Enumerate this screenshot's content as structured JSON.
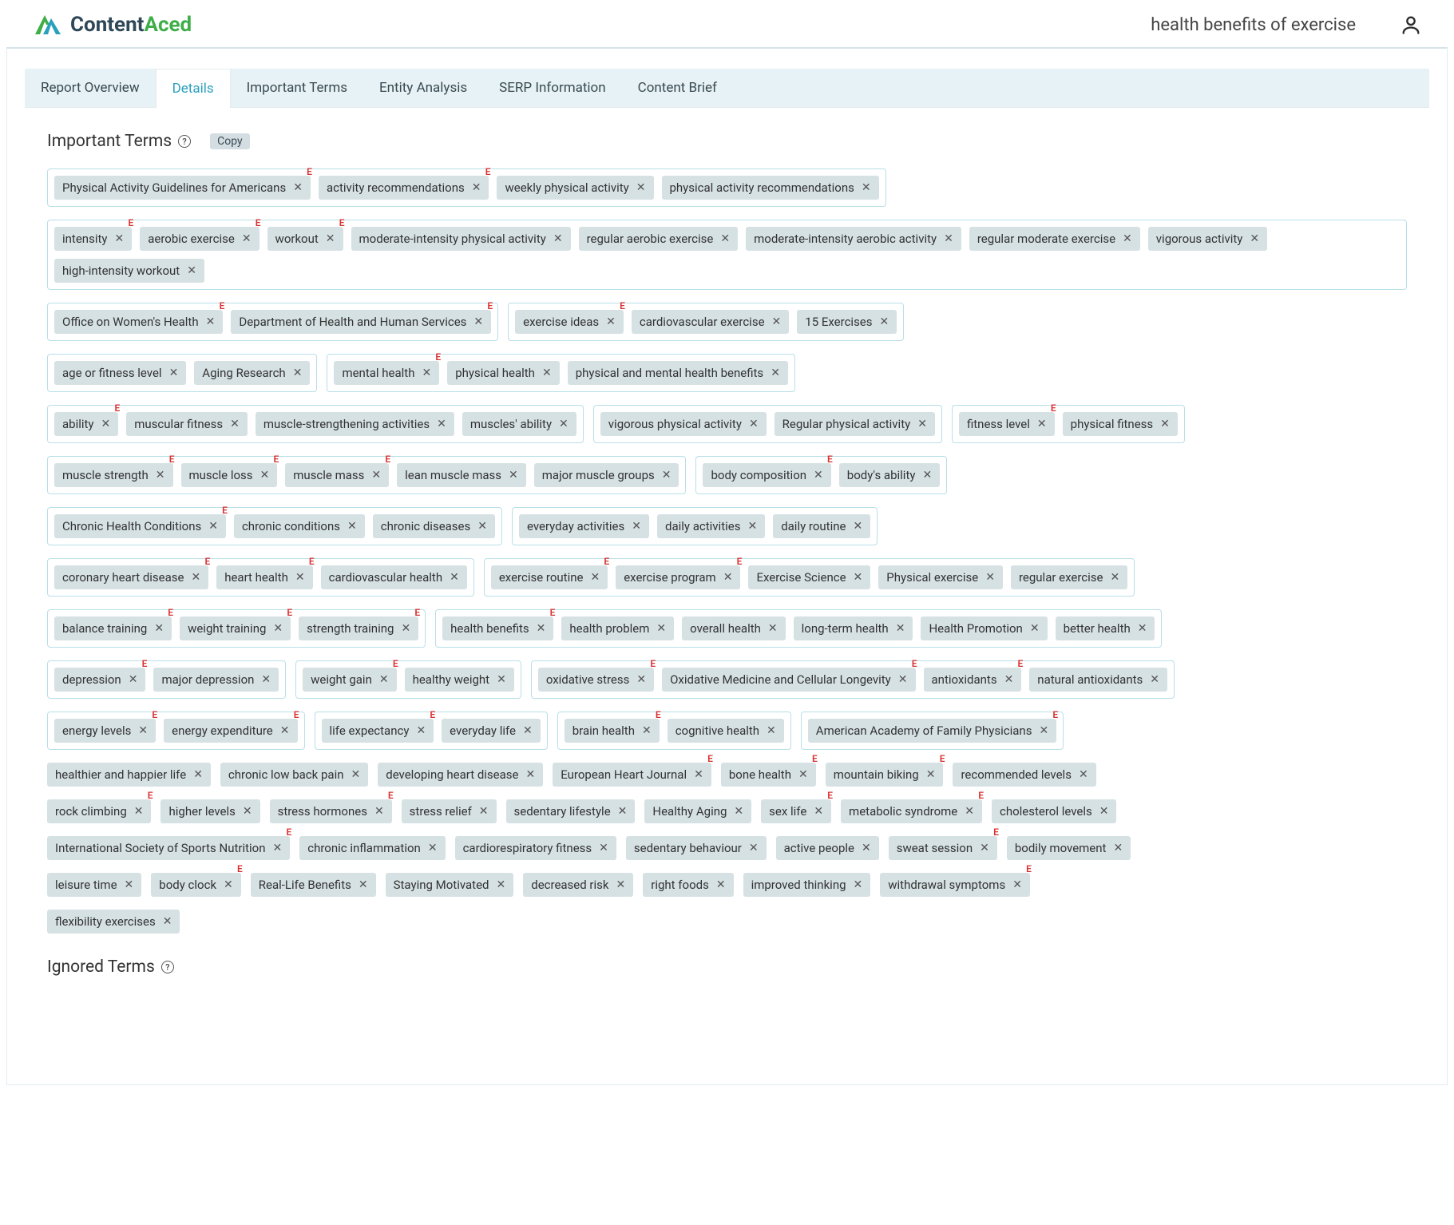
{
  "header": {
    "brand1": "Content",
    "brand2": "Aced",
    "title": "health benefits of exercise"
  },
  "tabs": [
    {
      "label": "Report Overview",
      "active": false
    },
    {
      "label": "Details",
      "active": true
    },
    {
      "label": "Important Terms",
      "active": false
    },
    {
      "label": "Entity Analysis",
      "active": false
    },
    {
      "label": "SERP Information",
      "active": false
    },
    {
      "label": "Content Brief",
      "active": false
    }
  ],
  "sections": {
    "important_title": "Important Terms",
    "copy_label": "Copy",
    "ignored_title": "Ignored Terms"
  },
  "rows": [
    [
      {
        "chips": [
          {
            "t": "Physical Activity Guidelines for Americans",
            "e": true
          },
          {
            "t": "activity recommendations",
            "e": true
          },
          {
            "t": "weekly physical activity"
          },
          {
            "t": "physical activity recommendations"
          }
        ]
      }
    ],
    [
      {
        "chips": [
          {
            "t": "intensity",
            "e": true
          },
          {
            "t": "aerobic exercise",
            "e": true
          },
          {
            "t": "workout",
            "e": true
          },
          {
            "t": "moderate-intensity physical activity"
          },
          {
            "t": "regular aerobic exercise"
          },
          {
            "t": "moderate-intensity aerobic activity"
          },
          {
            "t": "regular moderate exercise"
          },
          {
            "t": "vigorous activity"
          },
          {
            "t": "high-intensity workout"
          }
        ]
      }
    ],
    [
      {
        "chips": [
          {
            "t": "Office on Women's Health",
            "e": true
          },
          {
            "t": "Department of Health and Human Services",
            "e": true
          }
        ]
      },
      {
        "chips": [
          {
            "t": "exercise ideas",
            "e": true
          },
          {
            "t": "cardiovascular exercise"
          },
          {
            "t": "15 Exercises"
          }
        ]
      }
    ],
    [
      {
        "chips": [
          {
            "t": "age or fitness level"
          },
          {
            "t": "Aging Research"
          }
        ]
      },
      {
        "chips": [
          {
            "t": "mental health",
            "e": true
          },
          {
            "t": "physical health"
          },
          {
            "t": "physical and mental health benefits"
          }
        ]
      }
    ],
    [
      {
        "chips": [
          {
            "t": "ability",
            "e": true
          },
          {
            "t": "muscular fitness"
          },
          {
            "t": "muscle-strengthening activities"
          },
          {
            "t": "muscles' ability"
          }
        ]
      },
      {
        "chips": [
          {
            "t": "vigorous physical activity"
          },
          {
            "t": "Regular physical activity"
          }
        ]
      },
      {
        "chips": [
          {
            "t": "fitness level",
            "e": true
          },
          {
            "t": "physical fitness"
          }
        ]
      }
    ],
    [
      {
        "chips": [
          {
            "t": "muscle strength",
            "e": true
          },
          {
            "t": "muscle loss",
            "e": true
          },
          {
            "t": "muscle mass",
            "e": true
          },
          {
            "t": "lean muscle mass"
          },
          {
            "t": "major muscle groups"
          }
        ]
      },
      {
        "chips": [
          {
            "t": "body composition",
            "e": true
          },
          {
            "t": "body's ability"
          }
        ]
      }
    ],
    [
      {
        "chips": [
          {
            "t": "Chronic Health Conditions",
            "e": true
          },
          {
            "t": "chronic conditions"
          },
          {
            "t": "chronic diseases"
          }
        ]
      },
      {
        "chips": [
          {
            "t": "everyday activities"
          },
          {
            "t": "daily activities"
          },
          {
            "t": "daily routine"
          }
        ]
      }
    ],
    [
      {
        "chips": [
          {
            "t": "coronary heart disease",
            "e": true
          },
          {
            "t": "heart health",
            "e": true
          },
          {
            "t": "cardiovascular health"
          }
        ]
      },
      {
        "chips": [
          {
            "t": "exercise routine",
            "e": true
          },
          {
            "t": "exercise program",
            "e": true
          },
          {
            "t": "Exercise Science"
          },
          {
            "t": "Physical exercise"
          },
          {
            "t": "regular exercise"
          }
        ]
      }
    ],
    [
      {
        "chips": [
          {
            "t": "balance training",
            "e": true
          },
          {
            "t": "weight training",
            "e": true
          },
          {
            "t": "strength training",
            "e": true
          }
        ]
      },
      {
        "chips": [
          {
            "t": "health benefits",
            "e": true
          },
          {
            "t": "health problem"
          },
          {
            "t": "overall health"
          },
          {
            "t": "long-term health"
          },
          {
            "t": "Health Promotion"
          },
          {
            "t": "better health"
          }
        ]
      }
    ],
    [
      {
        "chips": [
          {
            "t": "depression",
            "e": true
          },
          {
            "t": "major depression"
          }
        ]
      },
      {
        "chips": [
          {
            "t": "weight gain",
            "e": true
          },
          {
            "t": "healthy weight"
          }
        ]
      },
      {
        "chips": [
          {
            "t": "oxidative stress",
            "e": true
          },
          {
            "t": "Oxidative Medicine and Cellular Longevity",
            "e": true
          },
          {
            "t": "antioxidants",
            "e": true
          },
          {
            "t": "natural antioxidants"
          }
        ]
      }
    ],
    [
      {
        "chips": [
          {
            "t": "energy levels",
            "e": true
          },
          {
            "t": "energy expenditure",
            "e": true
          }
        ]
      },
      {
        "chips": [
          {
            "t": "life expectancy",
            "e": true
          },
          {
            "t": "everyday life"
          }
        ]
      },
      {
        "chips": [
          {
            "t": "brain health",
            "e": true
          },
          {
            "t": "cognitive health"
          }
        ]
      },
      {
        "chips": [
          {
            "t": "American Academy of Family Physicians",
            "e": true
          }
        ]
      }
    ],
    [
      {
        "loose": true,
        "chips": [
          {
            "t": "healthier and happier life"
          },
          {
            "t": "chronic low back pain"
          },
          {
            "t": "developing heart disease"
          },
          {
            "t": "European Heart Journal",
            "e": true
          },
          {
            "t": "bone health",
            "e": true
          },
          {
            "t": "mountain biking",
            "e": true
          },
          {
            "t": "recommended levels"
          }
        ]
      }
    ],
    [
      {
        "loose": true,
        "chips": [
          {
            "t": "rock climbing",
            "e": true
          },
          {
            "t": "higher levels"
          },
          {
            "t": "stress hormones",
            "e": true
          },
          {
            "t": "stress relief"
          },
          {
            "t": "sedentary lifestyle"
          },
          {
            "t": "Healthy Aging"
          },
          {
            "t": "sex life",
            "e": true
          },
          {
            "t": "metabolic syndrome",
            "e": true
          },
          {
            "t": "cholesterol levels"
          }
        ]
      }
    ],
    [
      {
        "loose": true,
        "chips": [
          {
            "t": "International Society of Sports Nutrition",
            "e": true
          },
          {
            "t": "chronic inflammation"
          },
          {
            "t": "cardiorespiratory fitness"
          },
          {
            "t": "sedentary behaviour"
          },
          {
            "t": "active people"
          },
          {
            "t": "sweat session",
            "e": true
          },
          {
            "t": "bodily movement"
          }
        ]
      }
    ],
    [
      {
        "loose": true,
        "chips": [
          {
            "t": "leisure time"
          },
          {
            "t": "body clock",
            "e": true
          },
          {
            "t": "Real-Life Benefits"
          },
          {
            "t": "Staying Motivated"
          },
          {
            "t": "decreased risk"
          },
          {
            "t": "right foods"
          },
          {
            "t": "improved thinking"
          },
          {
            "t": "withdrawal symptoms",
            "e": true
          }
        ]
      }
    ],
    [
      {
        "loose": true,
        "chips": [
          {
            "t": "flexibility exercises"
          }
        ]
      }
    ]
  ]
}
